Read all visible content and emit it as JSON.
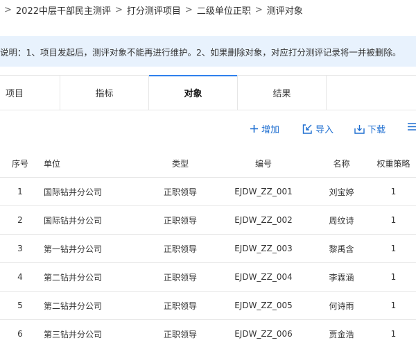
{
  "breadcrumb": {
    "items": [
      "2022中层干部民主测评",
      "打分测评项目",
      "二级单位正职",
      "测评对象"
    ],
    "separator": ">"
  },
  "notice": {
    "text": "说明：1、项目发起后，测评对象不能再进行维护。2、如果删除对象，对应打分测评记录将一并被删除。"
  },
  "tabs": [
    {
      "label": "项目",
      "active": false
    },
    {
      "label": "指标",
      "active": false
    },
    {
      "label": "对象",
      "active": true
    },
    {
      "label": "结果",
      "active": false
    },
    {
      "label": "",
      "active": false
    }
  ],
  "toolbar": {
    "add_label": "增加",
    "import_label": "导入",
    "download_label": "下载",
    "accent_color": "#1f6fd1"
  },
  "table": {
    "headers": {
      "index": "序号",
      "unit": "单位",
      "type": "类型",
      "code": "编号",
      "name": "名称",
      "weight": "权重策略"
    },
    "rows": [
      {
        "index": "1",
        "unit": "国际钻井分公司",
        "type": "正职领导",
        "code": "EJDW_ZZ_001",
        "name": "刘宝婷",
        "weight": "1"
      },
      {
        "index": "2",
        "unit": "国际钻井分公司",
        "type": "正职领导",
        "code": "EJDW_ZZ_002",
        "name": "周纹诗",
        "weight": "1"
      },
      {
        "index": "3",
        "unit": "第一钻井分公司",
        "type": "正职领导",
        "code": "EJDW_ZZ_003",
        "name": "黎禹含",
        "weight": "1"
      },
      {
        "index": "4",
        "unit": "第二钻井分公司",
        "type": "正职领导",
        "code": "EJDW_ZZ_004",
        "name": "李霖涵",
        "weight": "1"
      },
      {
        "index": "5",
        "unit": "第二钻井分公司",
        "type": "正职领导",
        "code": "EJDW_ZZ_005",
        "name": "何诗雨",
        "weight": "1"
      },
      {
        "index": "6",
        "unit": "第三钻井分公司",
        "type": "正职领导",
        "code": "EJDW_ZZ_006",
        "name": "贾金浩",
        "weight": "1"
      }
    ]
  }
}
